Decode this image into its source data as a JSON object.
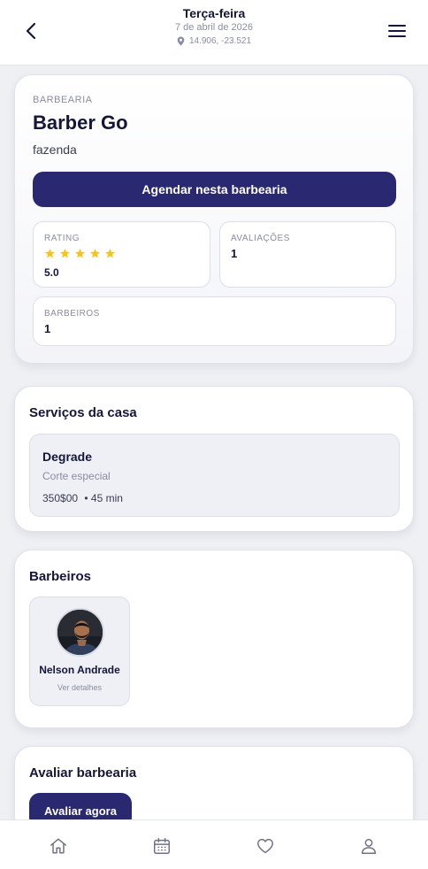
{
  "header": {
    "day": "Terça-feira",
    "date": "7 de abril de 2026",
    "location": "14.906, -23.521",
    "back_icon": "chevron-left-icon",
    "menu_icon": "hamburger-menu-icon"
  },
  "shop": {
    "eyebrow": "BARBEARIA",
    "name": "Barber Go",
    "subtitle": "fazenda",
    "cta_label": "Agendar nesta barbearia",
    "stats": {
      "rating_label": "RATING",
      "rating_stars": 5,
      "rating_value": "5.0",
      "reviews_label": "AVALIAÇÕES",
      "reviews_value": "1",
      "barbers_label": "BARBEIROS",
      "barbers_value": "1"
    }
  },
  "services": {
    "title": "Serviços da casa",
    "items": [
      {
        "name": "Degrade",
        "description": "Corte especial",
        "price": "350$00",
        "duration": "• 45 min"
      }
    ]
  },
  "barbers": {
    "title": "Barbeiros",
    "items": [
      {
        "name": "Nelson Andrade",
        "link": "Ver detalhes"
      }
    ]
  },
  "review": {
    "title": "Avaliar barbearia",
    "button_label": "Avaliar agora"
  },
  "bottom_nav": {
    "items": [
      "home-icon",
      "calendar-icon",
      "heart-icon",
      "user-icon"
    ]
  },
  "colors": {
    "primary": "#2b2872",
    "star": "#f5c518",
    "background": "#eef0f4",
    "text_dark": "#14163a",
    "text_muted": "#8a8ca3"
  }
}
